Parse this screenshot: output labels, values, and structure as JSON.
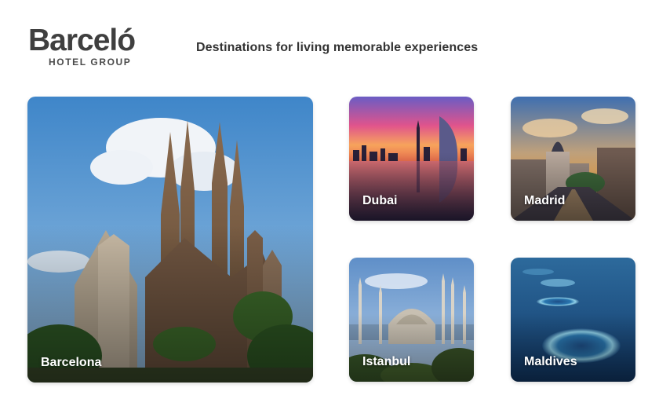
{
  "brand": {
    "name": "Barceló",
    "subtitle": "HOTEL GROUP",
    "tagline": "Destinations for living memorable experiences"
  },
  "destinations": [
    {
      "label": "Barcelona",
      "image": "sagrada-familia-photo"
    },
    {
      "label": "Dubai",
      "image": "dubai-skyline-sunset-photo"
    },
    {
      "label": "Madrid",
      "image": "madrid-gran-via-photo"
    },
    {
      "label": "Istanbul",
      "image": "blue-mosque-photo"
    },
    {
      "label": "Maldives",
      "image": "maldives-atolls-aerial-photo"
    }
  ]
}
